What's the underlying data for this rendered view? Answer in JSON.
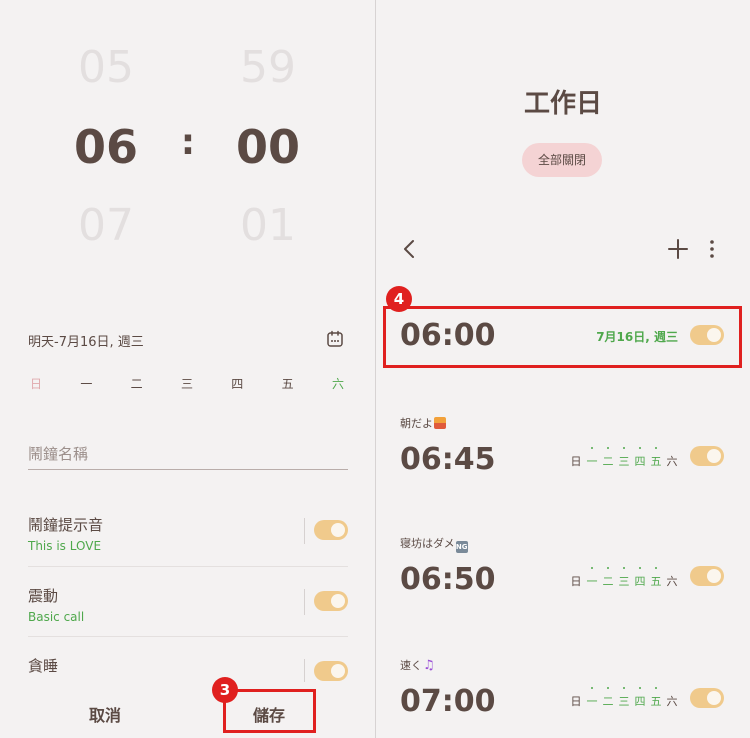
{
  "left": {
    "picker": {
      "hour_prev": "05",
      "hour": "06",
      "hour_next": "07",
      "minute_prev": "59",
      "minute": "00",
      "minute_next": "01",
      "separator": ":"
    },
    "date_text": "明天-7月16日, 週三",
    "weekdays": [
      "日",
      "一",
      "二",
      "三",
      "四",
      "五",
      "六"
    ],
    "alarm_name_placeholder": "鬧鐘名稱",
    "settings": [
      {
        "title": "鬧鐘提示音",
        "sub": "This is LOVE",
        "enabled": true
      },
      {
        "title": "震動",
        "sub": "Basic call",
        "enabled": true
      },
      {
        "title": "貪睡",
        "sub": "",
        "enabled": true
      }
    ],
    "cancel_label": "取消",
    "save_label": "儲存",
    "step_badge": "3"
  },
  "right": {
    "title": "工作日",
    "turn_off_all": "全部關閉",
    "step_badge": "4",
    "alarms": [
      {
        "label": "",
        "time": "06:00",
        "date": "7月16日, 週三",
        "enabled": true
      },
      {
        "label": "朝だよ",
        "emoji": "sunrise-emoji",
        "time": "06:45",
        "days": [
          "日",
          "一",
          "二",
          "三",
          "四",
          "五",
          "六"
        ],
        "active_days": [
          false,
          true,
          true,
          true,
          true,
          true,
          false
        ],
        "enabled": true
      },
      {
        "label": "寝坊はダメ",
        "emoji": "ng-emoji",
        "time": "06:50",
        "days": [
          "日",
          "一",
          "二",
          "三",
          "四",
          "五",
          "六"
        ],
        "active_days": [
          false,
          true,
          true,
          true,
          true,
          true,
          false
        ],
        "enabled": true
      },
      {
        "label": "速く",
        "emoji": "music-note-emoji",
        "time": "07:00",
        "days": [
          "日",
          "一",
          "二",
          "三",
          "四",
          "五",
          "六"
        ],
        "active_days": [
          false,
          true,
          true,
          true,
          true,
          true,
          false
        ],
        "enabled": true
      }
    ]
  },
  "colors": {
    "text": "#5b4a44",
    "accent_green": "#4fa84c",
    "toggle_on": "#f0ca8c",
    "highlight_red": "#e0201f",
    "pill_bg": "#f4d3d4",
    "background": "#f4f2f2"
  }
}
